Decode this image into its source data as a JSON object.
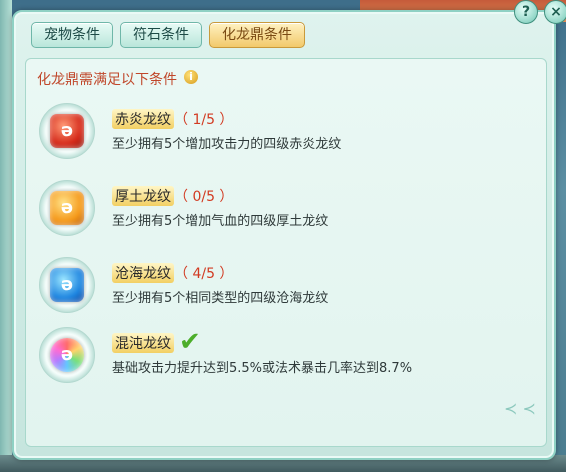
{
  "tabs": [
    {
      "label": "宠物条件",
      "active": false
    },
    {
      "label": "符石条件",
      "active": false
    },
    {
      "label": "化龙鼎条件",
      "active": true
    }
  ],
  "header": {
    "title": "化龙鼎需满足以下条件",
    "info_icon": "info-icon"
  },
  "items": [
    {
      "name": "赤炎龙纹",
      "count": "（ 1/5 ）",
      "desc": "至少拥有5个增加攻击力的四级赤炎龙纹",
      "gem": "red-gem-icon"
    },
    {
      "name": "厚土龙纹",
      "count": "（ 0/5 ）",
      "desc": "至少拥有5个增加气血的四级厚土龙纹",
      "gem": "orange-gem-icon"
    },
    {
      "name": "沧海龙纹",
      "count": "（ 4/5 ）",
      "desc": "至少拥有5个相同类型的四级沧海龙纹",
      "gem": "blue-gem-icon"
    },
    {
      "name": "混沌龙纹",
      "count": "",
      "desc": "基础攻击力提升达到5.5%或法术暴击几率达到8.7%",
      "gem": "rainbow-gem-icon",
      "completed": true
    }
  ],
  "window_buttons": {
    "help": "?",
    "close": "×"
  },
  "colors": {
    "accent": "#d23b22",
    "active_tab": "#f2c96b",
    "panel": "#dff3ee",
    "check": "#4cae2a"
  }
}
